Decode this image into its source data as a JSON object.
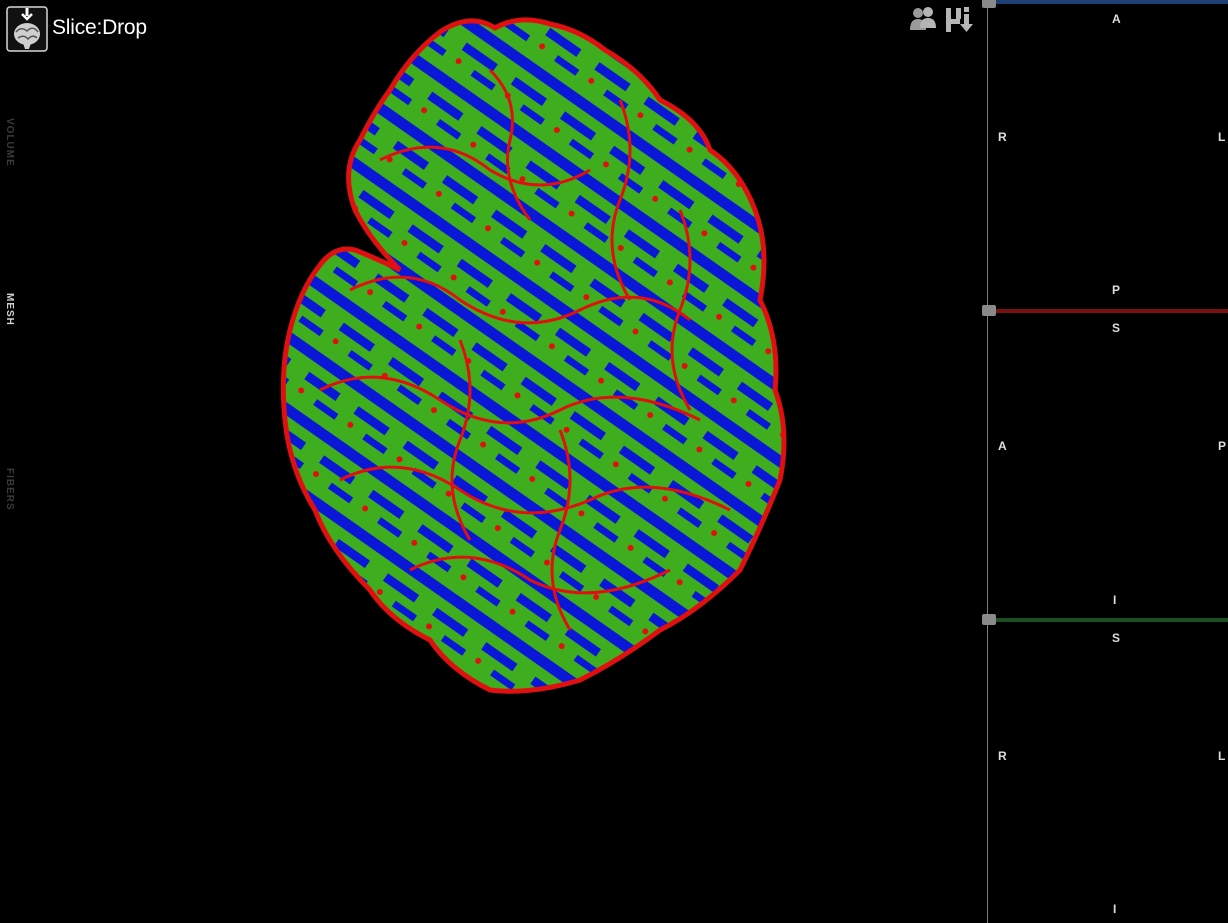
{
  "app": {
    "title": "Slice:Drop",
    "logo": "brain-logo-icon"
  },
  "sidebar": {
    "tabs": [
      {
        "label": "VOLUME",
        "active": false
      },
      {
        "label": "MESH",
        "active": true
      },
      {
        "label": "FIBERS",
        "active": false
      }
    ]
  },
  "toolbar": {
    "share_icon": "share-users-icon",
    "save_icon": "save-download-icon"
  },
  "viewport": {
    "content": "cortical-surface-mesh",
    "colors": {
      "base": "#3fae1e",
      "highlight": "#0b17d6",
      "outline": "#e11010",
      "background": "#000000"
    }
  },
  "panels": [
    {
      "name": "axial",
      "color": "#1e3f73",
      "labels": {
        "top": "A",
        "left": "R",
        "right": "L",
        "bottom": "P"
      }
    },
    {
      "name": "sagittal",
      "color": "#7a1010",
      "labels": {
        "top": "S",
        "left": "A",
        "right": "P",
        "bottom": "I"
      }
    },
    {
      "name": "coronal",
      "color": "#1d4d22",
      "labels": {
        "top": "S",
        "left": "R",
        "right": "L",
        "bottom": "I"
      }
    }
  ]
}
